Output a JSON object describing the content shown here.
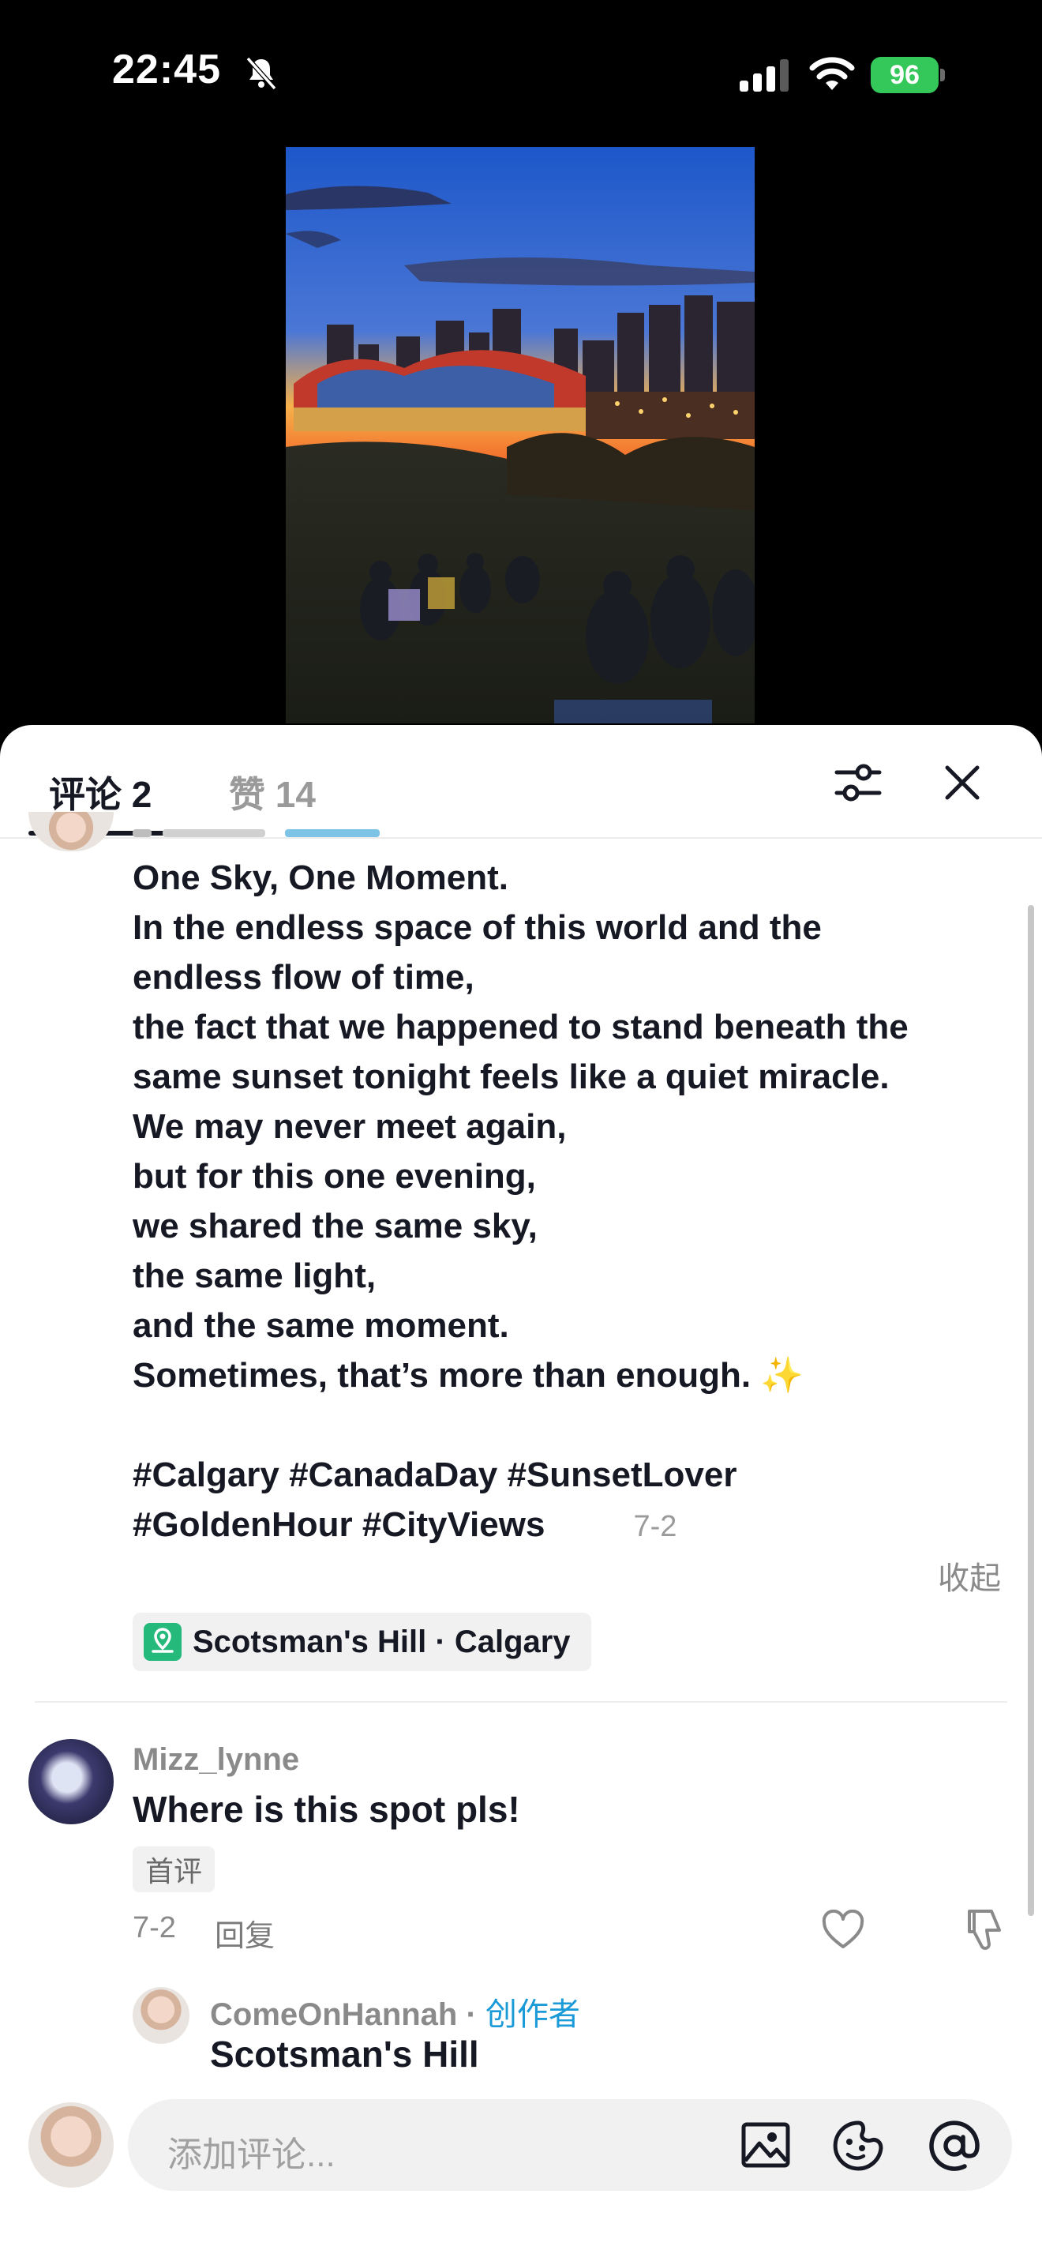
{
  "status_bar": {
    "time": "22:45",
    "battery": "96"
  },
  "tabs": [
    {
      "label": "评论 2"
    },
    {
      "label": "赞 14"
    }
  ],
  "post": {
    "caption_lines": [
      "One Sky, One Moment.",
      "In the endless space of this world and the",
      "endless flow of time,",
      "the fact that we happened to stand beneath the",
      "same sunset tonight feels like a quiet miracle.",
      "We may never meet again,",
      "but for this one evening,",
      "we shared the same sky,",
      "the same light,",
      "and the same moment.",
      "Sometimes, that’s more than enough."
    ],
    "sparkle": "✨",
    "hashtags_line1": "#Calgary #CanadaDay #SunsetLover",
    "hashtags_line2": "#GoldenHour #CityViews",
    "date": "7-2",
    "collapse_label": "收起",
    "location": "Scotsman's Hill · Calgary"
  },
  "comments": [
    {
      "username": "Mizz_lynne",
      "text": "Where is this spot pls!",
      "badge": "首评",
      "date": "7-2",
      "reply_label": "回复"
    }
  ],
  "reply": {
    "username": "ComeOnHannah",
    "separator": " · ",
    "creator_tag": "创作者",
    "text": "Scotsman's Hill"
  },
  "input": {
    "placeholder": "添加评论..."
  }
}
